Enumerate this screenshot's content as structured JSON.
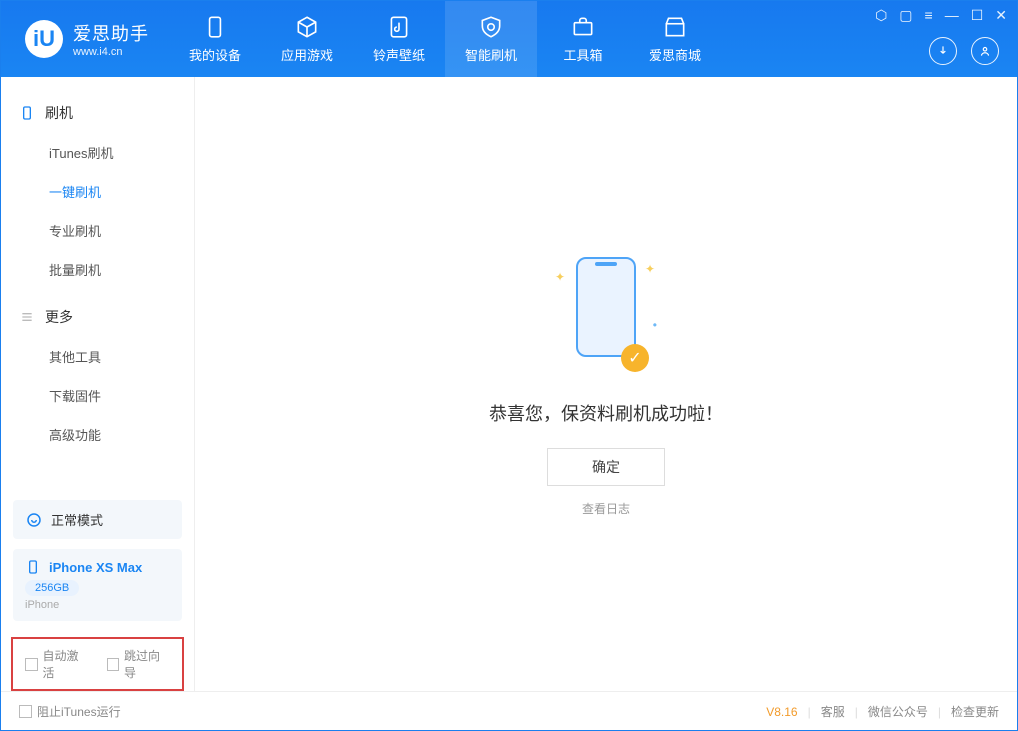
{
  "app": {
    "name": "爱思助手",
    "url": "www.i4.cn"
  },
  "tabs": [
    {
      "label": "我的设备"
    },
    {
      "label": "应用游戏"
    },
    {
      "label": "铃声壁纸"
    },
    {
      "label": "智能刷机"
    },
    {
      "label": "工具箱"
    },
    {
      "label": "爱思商城"
    }
  ],
  "sidebar": {
    "section1": {
      "title": "刷机",
      "items": [
        "iTunes刷机",
        "一键刷机",
        "专业刷机",
        "批量刷机"
      ],
      "active": 1
    },
    "section2": {
      "title": "更多",
      "items": [
        "其他工具",
        "下载固件",
        "高级功能"
      ]
    }
  },
  "mode": "正常模式",
  "device": {
    "name": "iPhone XS Max",
    "storage": "256GB",
    "type": "iPhone"
  },
  "checks": {
    "auto_activate": "自动激活",
    "skip_guide": "跳过向导"
  },
  "main": {
    "success": "恭喜您，保资料刷机成功啦！",
    "ok": "确定",
    "view_log": "查看日志"
  },
  "status": {
    "itunes_block": "阻止iTunes运行",
    "version": "V8.16",
    "links": [
      "客服",
      "微信公众号",
      "检查更新"
    ]
  }
}
